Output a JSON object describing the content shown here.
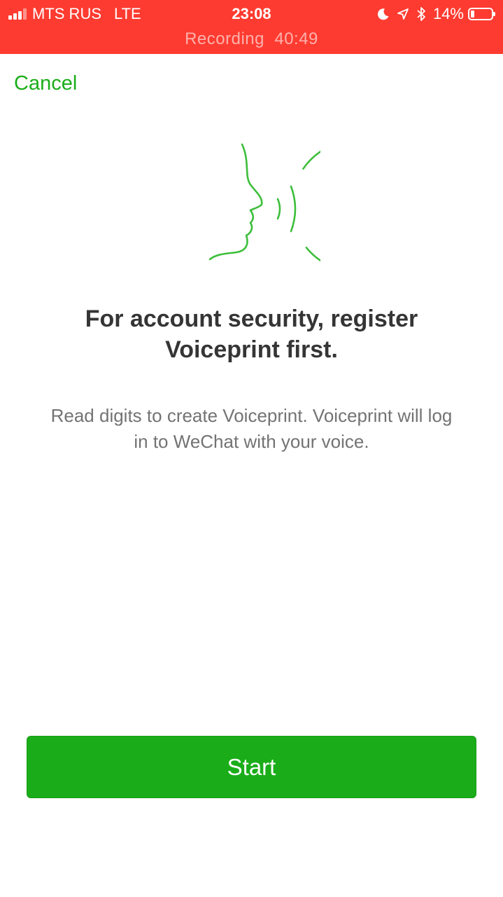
{
  "status_bar": {
    "carrier": "MTS RUS",
    "network": "LTE",
    "time": "23:08",
    "battery_percent": "14%",
    "recording_label": "Recording",
    "recording_time": "40:49",
    "background_color": "#fe3b30",
    "icons": [
      "signal-icon",
      "moon-icon",
      "location-arrow-icon",
      "bluetooth-icon",
      "battery-icon"
    ]
  },
  "nav": {
    "cancel_label": "Cancel"
  },
  "main": {
    "illustration_icon": "voice-profile-icon",
    "title": "For account security, register Voiceprint first.",
    "subtitle": "Read digits to create Voiceprint. Voiceprint will log in to WeChat with your voice."
  },
  "actions": {
    "start_label": "Start"
  },
  "colors": {
    "accent": "#1aad19",
    "illustration": "#3dbe3b",
    "title_text": "#353535",
    "subtitle_text": "#737373"
  }
}
